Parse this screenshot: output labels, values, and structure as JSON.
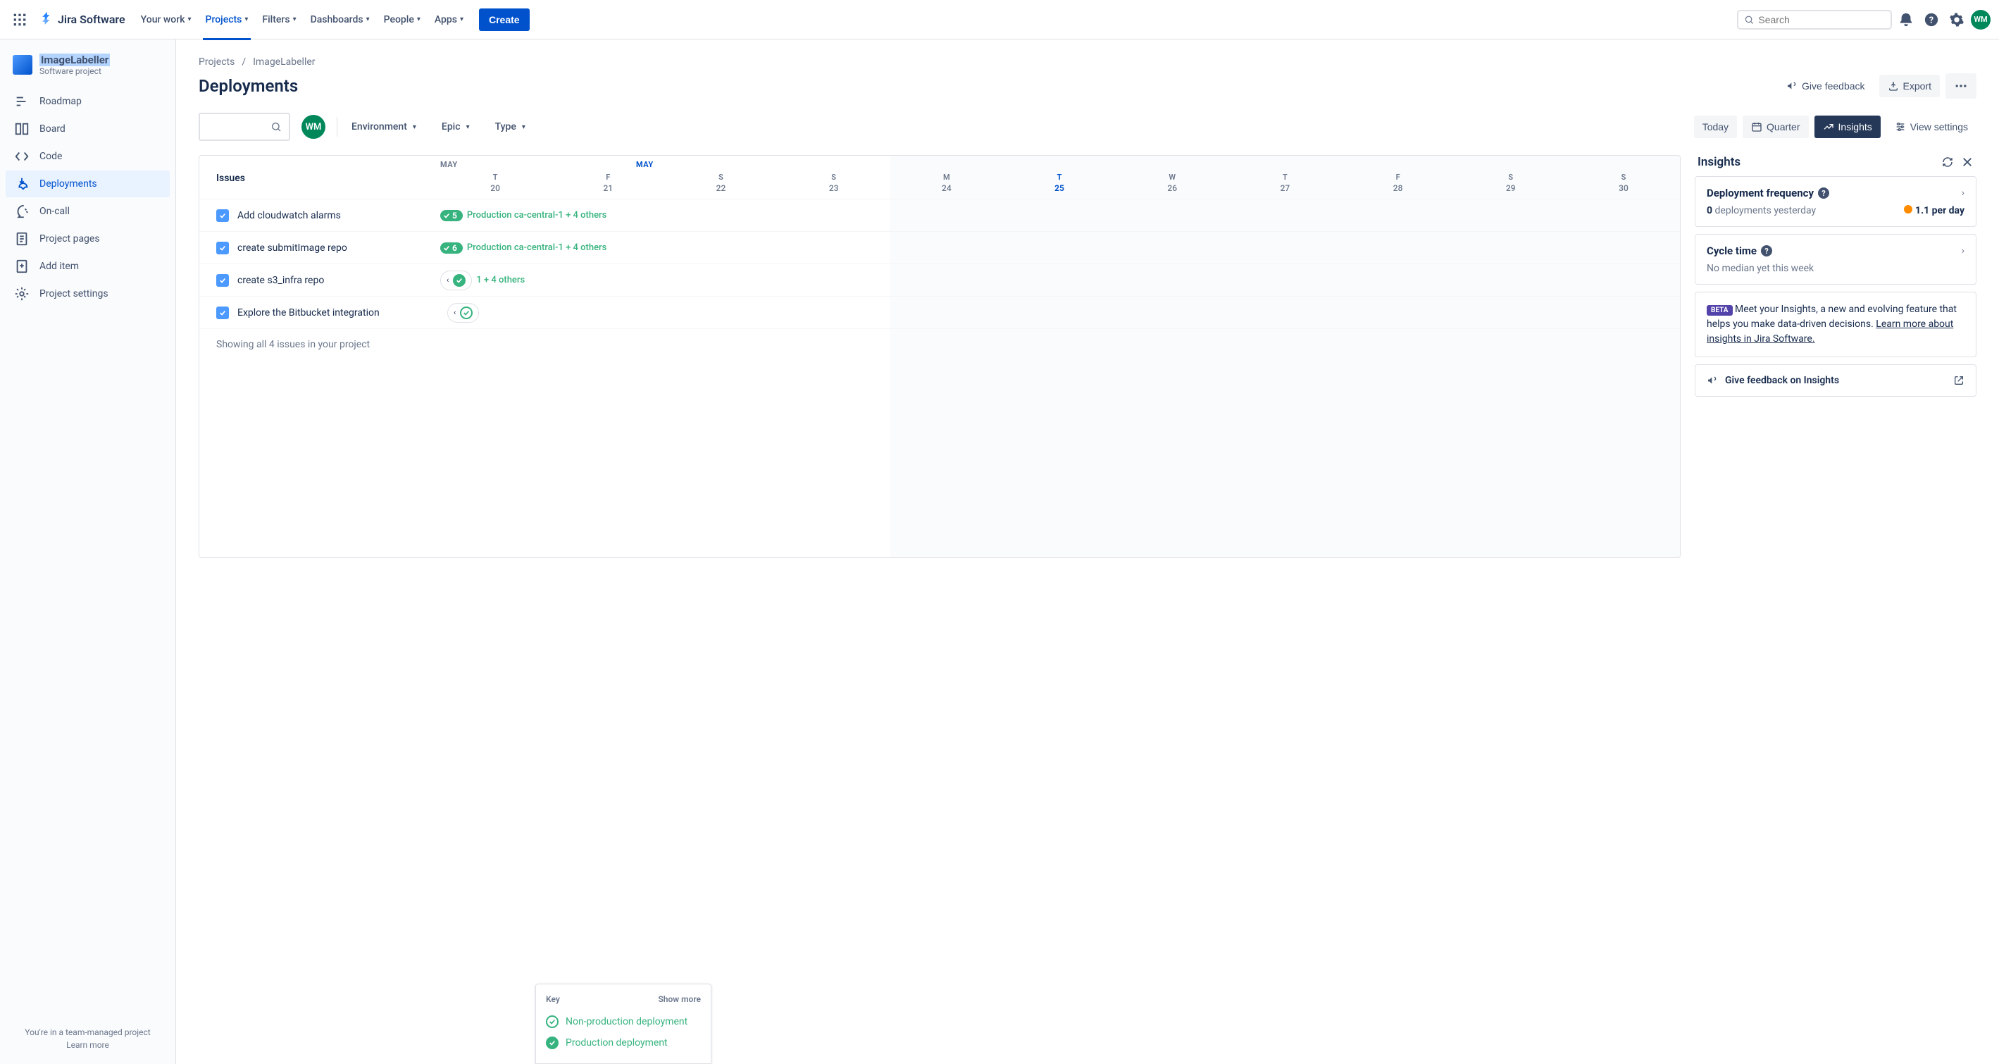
{
  "topnav": {
    "logo": "Jira Software",
    "items": [
      "Your work",
      "Projects",
      "Filters",
      "Dashboards",
      "People",
      "Apps"
    ],
    "active_index": 1,
    "create": "Create",
    "search_placeholder": "Search",
    "avatar_initials": "WM"
  },
  "sidebar": {
    "project_name": "ImageLabeller",
    "project_type": "Software project",
    "items": [
      "Roadmap",
      "Board",
      "Code",
      "Deployments",
      "On-call",
      "Project pages",
      "Add item",
      "Project settings"
    ],
    "active_index": 3,
    "footer_text": "You're in a team-managed project",
    "footer_link": "Learn more"
  },
  "breadcrumb": {
    "root": "Projects",
    "current": "ImageLabeller"
  },
  "page": {
    "title": "Deployments",
    "feedback": "Give feedback",
    "export": "Export"
  },
  "toolbar": {
    "avatar": "WM",
    "filters": [
      "Environment",
      "Epic",
      "Type"
    ],
    "today": "Today",
    "quarter": "Quarter",
    "insights": "Insights",
    "view_settings": "View settings"
  },
  "timeline": {
    "issues_header": "Issues",
    "month1": "MAY",
    "month2": "MAY",
    "days": [
      {
        "d": "T",
        "n": "20"
      },
      {
        "d": "F",
        "n": "21"
      },
      {
        "d": "S",
        "n": "22"
      },
      {
        "d": "S",
        "n": "23"
      },
      {
        "d": "M",
        "n": "24"
      },
      {
        "d": "T",
        "n": "25",
        "today": true
      },
      {
        "d": "W",
        "n": "26"
      },
      {
        "d": "T",
        "n": "27"
      },
      {
        "d": "F",
        "n": "28"
      },
      {
        "d": "S",
        "n": "29"
      },
      {
        "d": "S",
        "n": "30"
      }
    ],
    "rows": [
      {
        "title": "Add cloudwatch alarms",
        "badge": "5",
        "text": "Production ca-central-1 + 4 others",
        "type": "pill"
      },
      {
        "title": "create submitImage repo",
        "badge": "6",
        "text": "Production ca-central-1 + 4 others",
        "type": "pill"
      },
      {
        "title": "create s3_infra repo",
        "text": "1 + 4 others",
        "type": "circle"
      },
      {
        "title": "Explore the Bitbucket integration",
        "type": "single"
      }
    ],
    "showing": "Showing all 4 issues in your project"
  },
  "legend": {
    "key": "Key",
    "show_more": "Show more",
    "items": [
      "Non-production deployment",
      "Production deployment"
    ]
  },
  "insights": {
    "title": "Insights",
    "freq": {
      "title": "Deployment frequency",
      "count": "0",
      "count_label": "deployments yesterday",
      "rate": "1.1 per day"
    },
    "cycle": {
      "title": "Cycle time",
      "body": "No median yet this week"
    },
    "beta": {
      "badge": "BETA",
      "text": "Meet your Insights, a new and evolving feature that helps you make data-driven decisions.",
      "link": "Learn more about insights in Jira Software."
    },
    "feedback": "Give feedback on Insights"
  }
}
